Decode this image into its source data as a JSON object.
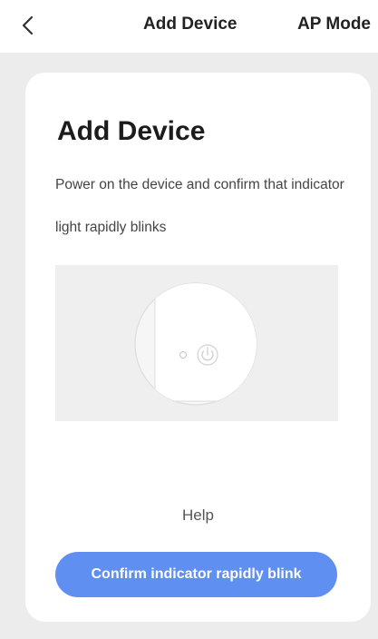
{
  "header": {
    "title": "Add Device",
    "mode_label": "AP Mode",
    "back_icon": "chevron-left-icon"
  },
  "card": {
    "title": "Add Device",
    "description": "Power on the device and confirm that indicator light rapidly blinks",
    "illustration_icon": "power-icon",
    "help_label": "Help",
    "confirm_label": "Confirm indicator rapidly blink"
  },
  "colors": {
    "page_background": "#ececec",
    "card_background": "#ffffff",
    "accent": "#5f8ff0",
    "illustration_background": "#efefef"
  }
}
